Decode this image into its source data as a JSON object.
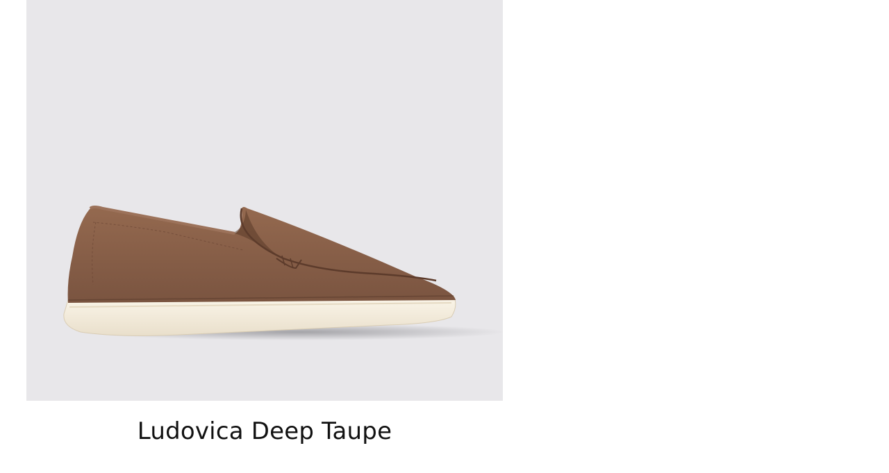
{
  "product": {
    "name": "Ludovica Deep Taupe",
    "image_subject": "loafer-shoe-illustration"
  },
  "colors": {
    "image_background": "#e8e7ea",
    "suede": "#8a6048",
    "sole": "#f3ecdd",
    "text": "#111111"
  }
}
